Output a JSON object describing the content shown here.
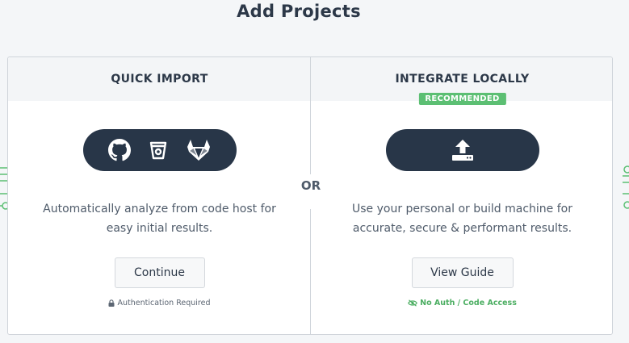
{
  "page": {
    "title": "Add Projects"
  },
  "left": {
    "header": "QUICK IMPORT",
    "icons": [
      "github-icon",
      "bitbucket-icon",
      "gitlab-icon"
    ],
    "description": "Automatically analyze from code host for easy initial results.",
    "button_label": "Continue",
    "note": "Authentication Required",
    "note_icon": "lock-icon"
  },
  "divider": {
    "label": "OR"
  },
  "right": {
    "header": "INTEGRATE LOCALLY",
    "badge": "RECOMMENDED",
    "icons": [
      "upload-icon"
    ],
    "description": "Use your personal or build machine for accurate, secure & performant results.",
    "button_label": "View Guide",
    "note": "No Auth / Code Access",
    "note_icon": "eye-slash-icon"
  },
  "colors": {
    "background": "#f4f6f8",
    "dark": "#283648",
    "accent_green": "#5cbf73",
    "text": "#2c3848"
  }
}
